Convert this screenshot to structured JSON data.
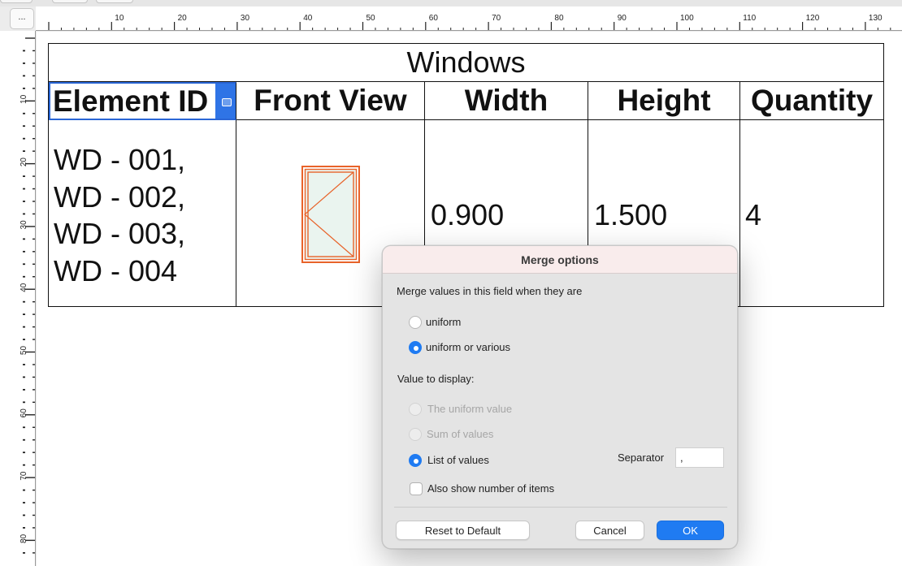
{
  "toolbar": {
    "ruler_corner_label": "..."
  },
  "ruler": {
    "horizontal_labels": [
      "10",
      "20",
      "30",
      "40",
      "50",
      "60",
      "70",
      "80",
      "90",
      "100",
      "110",
      "120",
      "130"
    ],
    "vertical_labels": [
      "10",
      "20",
      "30",
      "40",
      "50",
      "60",
      "70",
      "80"
    ]
  },
  "schedule": {
    "title": "Windows",
    "headers": [
      "Element ID",
      "Front View",
      "Width",
      "Height",
      "Quantity"
    ],
    "row": {
      "element_ids": [
        "WD - 001,",
        "WD - 002,",
        "WD - 003,",
        "WD - 004"
      ],
      "width": "0.900",
      "height": "1.500",
      "quantity": "4"
    },
    "elevation_stroke_color": "#e8632a",
    "elevation_glass_color": "#eaf4ef"
  },
  "dialog": {
    "title": "Merge options",
    "merge_prompt": "Merge values in this field when they are",
    "merge_options": [
      {
        "label": "uniform",
        "selected": false
      },
      {
        "label": "uniform or various",
        "selected": true
      }
    ],
    "display_prompt": "Value to display:",
    "display_options": [
      {
        "label": "The uniform value",
        "selected": false,
        "enabled": false
      },
      {
        "label": "Sum of values",
        "selected": false,
        "enabled": false
      },
      {
        "label": "List of values",
        "selected": true,
        "enabled": true
      }
    ],
    "separator_label": "Separator",
    "separator_value": ",",
    "show_count_label": "Also show number of items",
    "show_count_checked": false,
    "buttons": {
      "reset": "Reset to Default",
      "cancel": "Cancel",
      "ok": "OK"
    },
    "accent_color": "#1f7bf2"
  }
}
